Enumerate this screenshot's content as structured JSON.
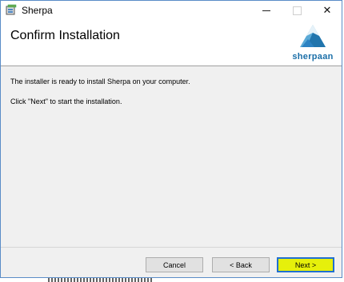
{
  "window": {
    "title": "Sherpa"
  },
  "header": {
    "title": "Confirm Installation",
    "logo_text": "sherpaan"
  },
  "content": {
    "line1": "The installer is ready to install Sherpa on your computer.",
    "line2": "Click \"Next\" to start the installation."
  },
  "buttons": {
    "cancel": "Cancel",
    "back": "< Back",
    "next": "Next >"
  },
  "titlebar_controls": {
    "close_glyph": "✕"
  },
  "colors": {
    "logo_blue": "#1b6fa8",
    "next_highlight": "#e6f00b",
    "focus_border": "#1f6fd1"
  }
}
